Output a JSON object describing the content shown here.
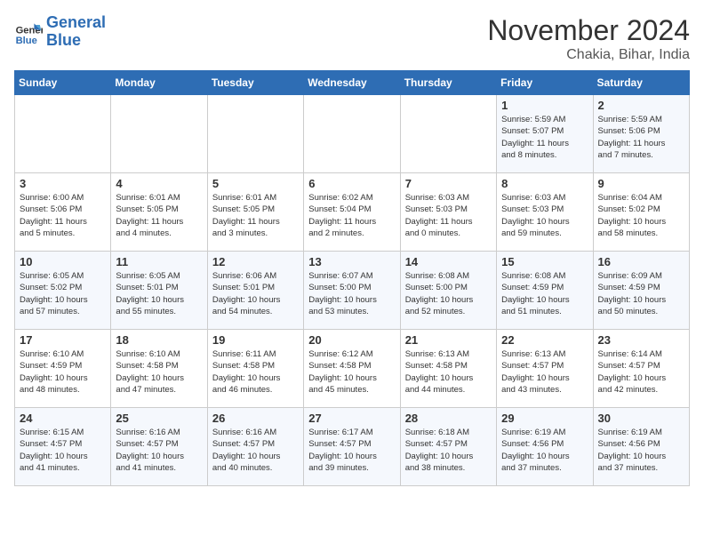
{
  "logo": {
    "name1": "General",
    "name2": "Blue"
  },
  "title": "November 2024",
  "subtitle": "Chakia, Bihar, India",
  "weekdays": [
    "Sunday",
    "Monday",
    "Tuesday",
    "Wednesday",
    "Thursday",
    "Friday",
    "Saturday"
  ],
  "weeks": [
    [
      {
        "day": "",
        "info": ""
      },
      {
        "day": "",
        "info": ""
      },
      {
        "day": "",
        "info": ""
      },
      {
        "day": "",
        "info": ""
      },
      {
        "day": "",
        "info": ""
      },
      {
        "day": "1",
        "info": "Sunrise: 5:59 AM\nSunset: 5:07 PM\nDaylight: 11 hours\nand 8 minutes."
      },
      {
        "day": "2",
        "info": "Sunrise: 5:59 AM\nSunset: 5:06 PM\nDaylight: 11 hours\nand 7 minutes."
      }
    ],
    [
      {
        "day": "3",
        "info": "Sunrise: 6:00 AM\nSunset: 5:06 PM\nDaylight: 11 hours\nand 5 minutes."
      },
      {
        "day": "4",
        "info": "Sunrise: 6:01 AM\nSunset: 5:05 PM\nDaylight: 11 hours\nand 4 minutes."
      },
      {
        "day": "5",
        "info": "Sunrise: 6:01 AM\nSunset: 5:05 PM\nDaylight: 11 hours\nand 3 minutes."
      },
      {
        "day": "6",
        "info": "Sunrise: 6:02 AM\nSunset: 5:04 PM\nDaylight: 11 hours\nand 2 minutes."
      },
      {
        "day": "7",
        "info": "Sunrise: 6:03 AM\nSunset: 5:03 PM\nDaylight: 11 hours\nand 0 minutes."
      },
      {
        "day": "8",
        "info": "Sunrise: 6:03 AM\nSunset: 5:03 PM\nDaylight: 10 hours\nand 59 minutes."
      },
      {
        "day": "9",
        "info": "Sunrise: 6:04 AM\nSunset: 5:02 PM\nDaylight: 10 hours\nand 58 minutes."
      }
    ],
    [
      {
        "day": "10",
        "info": "Sunrise: 6:05 AM\nSunset: 5:02 PM\nDaylight: 10 hours\nand 57 minutes."
      },
      {
        "day": "11",
        "info": "Sunrise: 6:05 AM\nSunset: 5:01 PM\nDaylight: 10 hours\nand 55 minutes."
      },
      {
        "day": "12",
        "info": "Sunrise: 6:06 AM\nSunset: 5:01 PM\nDaylight: 10 hours\nand 54 minutes."
      },
      {
        "day": "13",
        "info": "Sunrise: 6:07 AM\nSunset: 5:00 PM\nDaylight: 10 hours\nand 53 minutes."
      },
      {
        "day": "14",
        "info": "Sunrise: 6:08 AM\nSunset: 5:00 PM\nDaylight: 10 hours\nand 52 minutes."
      },
      {
        "day": "15",
        "info": "Sunrise: 6:08 AM\nSunset: 4:59 PM\nDaylight: 10 hours\nand 51 minutes."
      },
      {
        "day": "16",
        "info": "Sunrise: 6:09 AM\nSunset: 4:59 PM\nDaylight: 10 hours\nand 50 minutes."
      }
    ],
    [
      {
        "day": "17",
        "info": "Sunrise: 6:10 AM\nSunset: 4:59 PM\nDaylight: 10 hours\nand 48 minutes."
      },
      {
        "day": "18",
        "info": "Sunrise: 6:10 AM\nSunset: 4:58 PM\nDaylight: 10 hours\nand 47 minutes."
      },
      {
        "day": "19",
        "info": "Sunrise: 6:11 AM\nSunset: 4:58 PM\nDaylight: 10 hours\nand 46 minutes."
      },
      {
        "day": "20",
        "info": "Sunrise: 6:12 AM\nSunset: 4:58 PM\nDaylight: 10 hours\nand 45 minutes."
      },
      {
        "day": "21",
        "info": "Sunrise: 6:13 AM\nSunset: 4:58 PM\nDaylight: 10 hours\nand 44 minutes."
      },
      {
        "day": "22",
        "info": "Sunrise: 6:13 AM\nSunset: 4:57 PM\nDaylight: 10 hours\nand 43 minutes."
      },
      {
        "day": "23",
        "info": "Sunrise: 6:14 AM\nSunset: 4:57 PM\nDaylight: 10 hours\nand 42 minutes."
      }
    ],
    [
      {
        "day": "24",
        "info": "Sunrise: 6:15 AM\nSunset: 4:57 PM\nDaylight: 10 hours\nand 41 minutes."
      },
      {
        "day": "25",
        "info": "Sunrise: 6:16 AM\nSunset: 4:57 PM\nDaylight: 10 hours\nand 41 minutes."
      },
      {
        "day": "26",
        "info": "Sunrise: 6:16 AM\nSunset: 4:57 PM\nDaylight: 10 hours\nand 40 minutes."
      },
      {
        "day": "27",
        "info": "Sunrise: 6:17 AM\nSunset: 4:57 PM\nDaylight: 10 hours\nand 39 minutes."
      },
      {
        "day": "28",
        "info": "Sunrise: 6:18 AM\nSunset: 4:57 PM\nDaylight: 10 hours\nand 38 minutes."
      },
      {
        "day": "29",
        "info": "Sunrise: 6:19 AM\nSunset: 4:56 PM\nDaylight: 10 hours\nand 37 minutes."
      },
      {
        "day": "30",
        "info": "Sunrise: 6:19 AM\nSunset: 4:56 PM\nDaylight: 10 hours\nand 37 minutes."
      }
    ]
  ]
}
